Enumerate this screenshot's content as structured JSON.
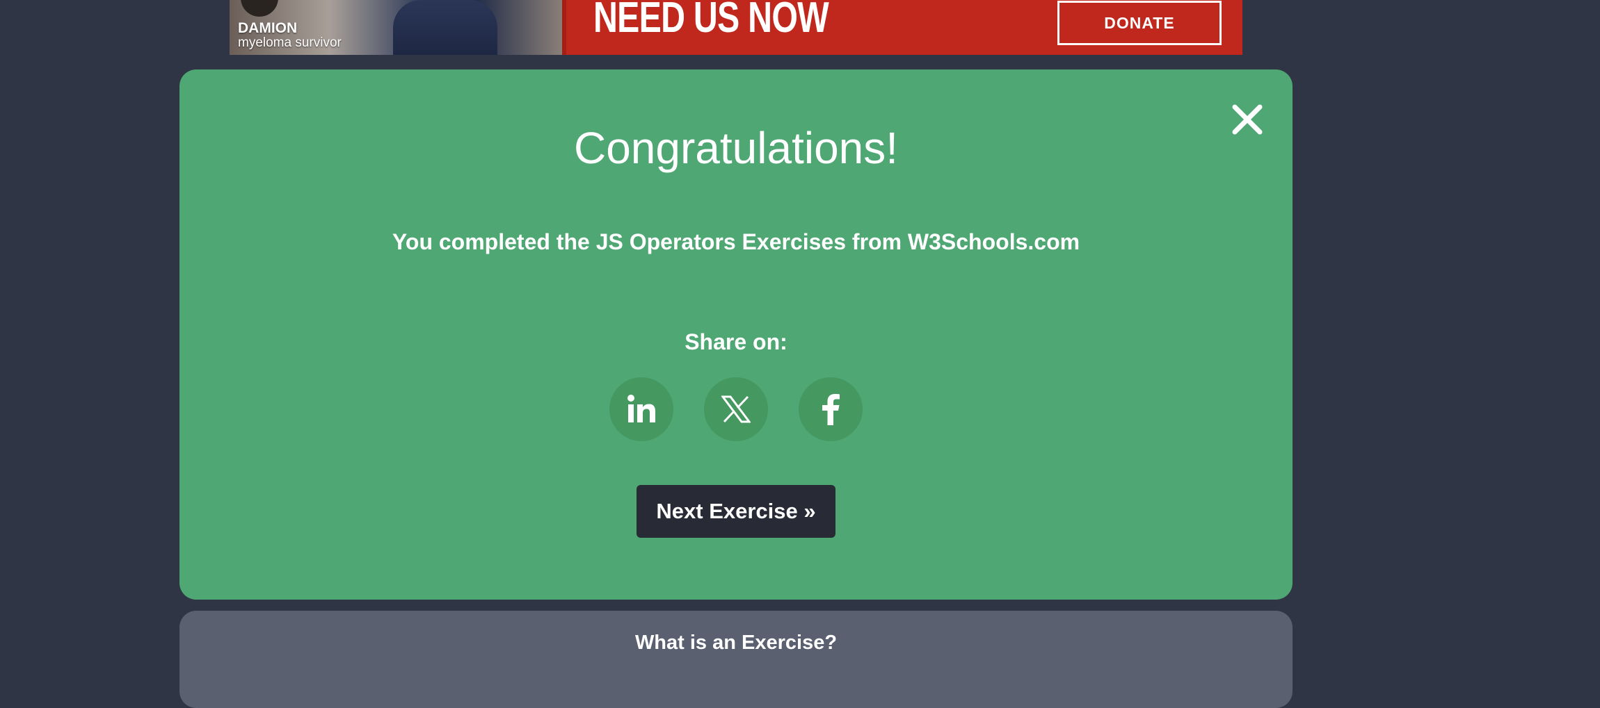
{
  "ad": {
    "person_name": "DAMION",
    "person_caption": "myeloma survivor",
    "headline": "NEED US NOW",
    "donate_label": "DONATE",
    "background_color": "#c0281e"
  },
  "modal": {
    "title": "Congratulations!",
    "message": "You completed the JS Operators Exercises from W3Schools.com",
    "share_label": "Share on:",
    "share_icons": [
      "linkedin-icon",
      "x-icon",
      "facebook-icon"
    ],
    "next_label": "Next Exercise »",
    "close_icon": "close-icon",
    "background_color": "#4fa774"
  },
  "info_panel": {
    "title": "What is an Exercise?"
  }
}
